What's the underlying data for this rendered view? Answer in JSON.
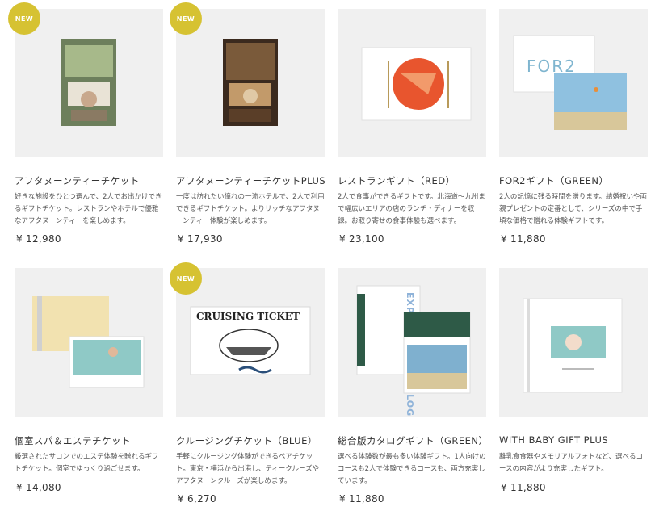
{
  "products": [
    {
      "badge": "NEW",
      "title": "アフタヌーンティーチケット",
      "description": "好きな施設をひとつ選んで、2人でお出かけできるギフトチケット。レストランやホテルで優雅なアフタヌーンティーを楽しめます。",
      "price": "¥ 12,980"
    },
    {
      "badge": "NEW",
      "title": "アフタヌーンティーチケットPLUS",
      "description": "一度は訪れたい憧れの一流ホテルで、2人で利用できるギフトチケット。よりリッチなアフタヌーンティー体験が楽しめます。",
      "price": "¥ 17,930"
    },
    {
      "title": "レストランギフト（RED）",
      "description": "2人で食事ができるギフトです。北海道～九州まで幅広いエリアの店のランチ・ディナーを収録。お取り寄せの食事体験も選べます。",
      "price": "¥ 23,100"
    },
    {
      "title": "FOR2ギフト（GREEN）",
      "description": "2人の記憶に残る時間を贈ります。結婚祝いや両親プレゼントの定番として、シリーズの中で手頃な価格で贈れる体験ギフトです。",
      "price": "¥ 11,880",
      "image_text": "FOR2"
    },
    {
      "title": "個室スパ＆エステチケット",
      "description": "厳選されたサロンでのエステ体験を贈れるギフトチケット。個室でゆっくり過ごせます。",
      "price": "¥ 14,080"
    },
    {
      "badge": "NEW",
      "title": "クルージングチケット（BLUE）",
      "description": "手軽にクルージング体験ができるペアチケット。東京・横浜から出港し、ティークルーズやアフタヌーンクルーズが楽しめます。",
      "price": "¥ 6,270",
      "image_text": "CRUISING TICKET"
    },
    {
      "title": "総合版カタログギフト（GREEN）",
      "description": "選べる体験数が最も多い体験ギフト。1人向けのコースも2人で体験できるコースも、両方充実しています。",
      "price": "¥ 11,880",
      "image_text": "EXPERIENCE CATALOG"
    },
    {
      "title": "WITH BABY GIFT PLUS",
      "description": "離乳食食器やメモリアルフォトなど、選べるコースの内容がより充実したギフト。",
      "price": "¥ 11,880"
    }
  ],
  "colors": {
    "badge": "#d6c232",
    "thumb_bg": "#f0f0f0",
    "text": "#333333"
  }
}
